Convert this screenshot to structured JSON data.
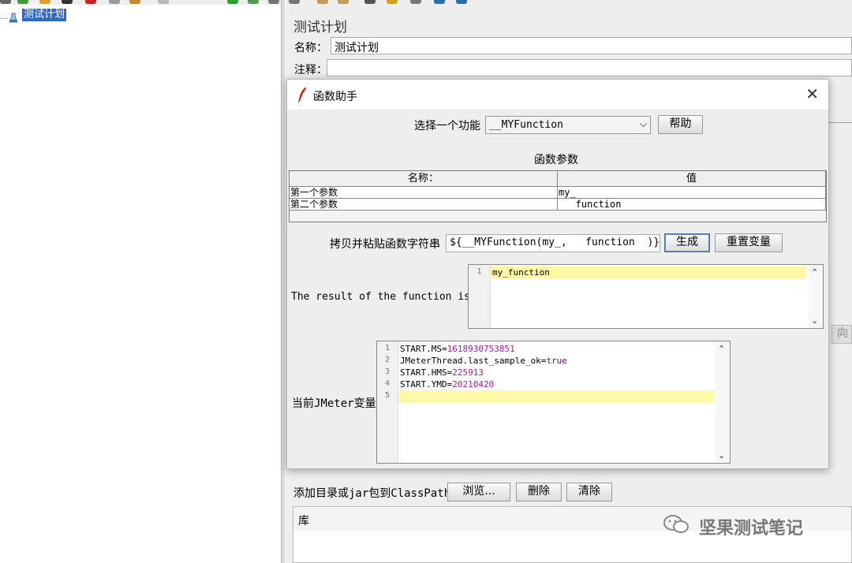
{
  "toolbar": {
    "colors": [
      "#3a9c3a",
      "#e07b1a",
      "#333333",
      "#c22222",
      "#888888",
      "#c58a2a",
      "#9b9b9b",
      "#30a030",
      "#707070",
      "#c79a5a",
      "#2a6fb0"
    ]
  },
  "tree": {
    "root_label": "测试计划"
  },
  "panel": {
    "title": "测试计划",
    "name_label": "名称：",
    "name_value": "测试计划",
    "comment_label": "注释：",
    "classpath_label": "添加目录或jar包到ClassPath",
    "browse": "浏览...",
    "delete": "删除",
    "clear": "清除",
    "library_header": "库",
    "side_button": "向"
  },
  "dialog": {
    "title": "函数助手",
    "select_label": "选择一个功能",
    "selected_function": "__MYFunction",
    "help": "帮助",
    "params_title": "函数参数",
    "table": {
      "headers": [
        "名称：",
        "值"
      ],
      "rows": [
        {
          "name": "第一个参数",
          "value": "my_"
        },
        {
          "name": "第二个参数",
          "value": "   function"
        }
      ]
    },
    "copy_label": "拷贝并粘贴函数字符串",
    "function_string": "${__MYFunction(my_,   function  )}",
    "generate": "生成",
    "reset": "重置变量",
    "result_label": "The result of the function is",
    "result_lines": [
      "my_function"
    ],
    "vars_label": "当前JMeter变量",
    "vars": [
      {
        "ln": "1",
        "key": "START.MS=",
        "val": "1618930753851"
      },
      {
        "ln": "2",
        "key": "JMeterThread.last_sample_ok=",
        "val": "true"
      },
      {
        "ln": "3",
        "key": "START.HMS=",
        "val": "225913"
      },
      {
        "ln": "4",
        "key": "START.YMD=",
        "val": "20210420"
      },
      {
        "ln": "5",
        "key": "",
        "val": ""
      }
    ]
  },
  "watermark": {
    "text": "坚果测试笔记"
  }
}
